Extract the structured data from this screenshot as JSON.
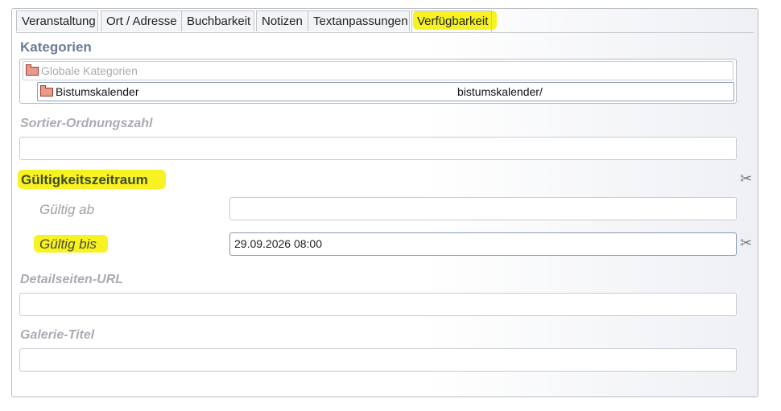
{
  "tabs": [
    {
      "label": "Veranstaltung",
      "active": false
    },
    {
      "label": "Ort / Adresse",
      "active": false
    },
    {
      "label": "Buchbarkeit",
      "active": false
    },
    {
      "label": "Notizen",
      "active": false
    },
    {
      "label": "Textanpassungen",
      "active": false
    },
    {
      "label": "Verfügbarkeit",
      "active": true
    }
  ],
  "categories": {
    "title": "Kategorien",
    "root": {
      "label": "Globale Kategorien"
    },
    "child": {
      "label": "Bistumskalender",
      "path": "bistumskalender/"
    }
  },
  "sort_order": {
    "label": "Sortier-Ordnungszahl",
    "value": ""
  },
  "validity": {
    "title": "Gültigkeitszeitraum",
    "from_label": "Gültig ab",
    "from_value": "",
    "until_label": "Gültig bis",
    "until_value": "29.09.2026 08:00"
  },
  "detail_url": {
    "label": "Detailseiten-URL",
    "value": ""
  },
  "gallery_title": {
    "label": "Galerie-Titel",
    "value": ""
  },
  "icons": {
    "clear": "scissors-icon",
    "folder": "folder-icon"
  },
  "colors": {
    "highlight": "#f6f10f",
    "section_title": "#6a7b9a",
    "field_label": "#a9acb2"
  }
}
